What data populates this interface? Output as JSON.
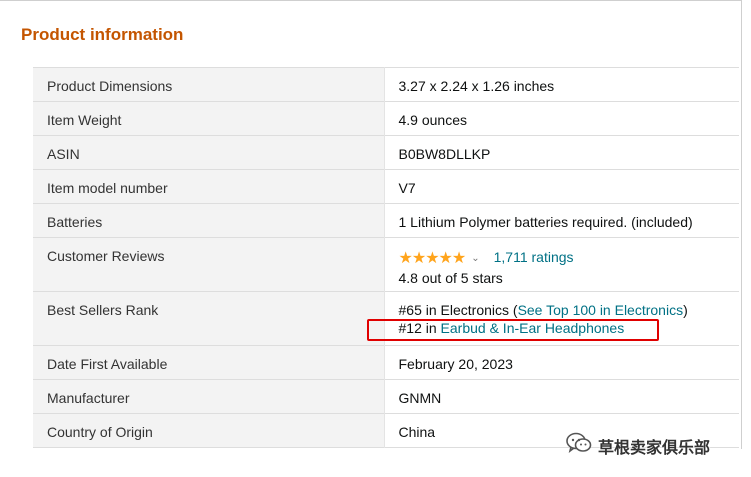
{
  "section_title": "Product information",
  "rows": {
    "dimensions": {
      "label": "Product Dimensions",
      "value": "3.27 x 2.24 x 1.26 inches"
    },
    "weight": {
      "label": "Item Weight",
      "value": "4.9 ounces"
    },
    "asin": {
      "label": "ASIN",
      "value": "B0BW8DLLKP"
    },
    "model": {
      "label": "Item model number",
      "value": "V7"
    },
    "batteries": {
      "label": "Batteries",
      "value": "1 Lithium Polymer batteries required. (included)"
    },
    "reviews": {
      "label": "Customer Reviews",
      "stars": "★★★★★",
      "rating": 4.8,
      "chevron": "⌄",
      "ratings_link": "1,711 ratings",
      "out_of": "4.8 out of 5 stars"
    },
    "rank": {
      "label": "Best Sellers Rank",
      "line1_prefix": "#65 in Electronics (",
      "line1_link": "See Top 100 in Electronics",
      "line1_suffix": ")",
      "line2_prefix": "#12 in ",
      "line2_link": "Earbud & In-Ear Headphones"
    },
    "date": {
      "label": "Date First Available",
      "value": "February 20, 2023"
    },
    "manufacturer": {
      "label": "Manufacturer",
      "value": "GNMN"
    },
    "origin": {
      "label": "Country of Origin",
      "value": "China"
    }
  },
  "colors": {
    "title": "#c45500",
    "link": "#007185",
    "star": "#ffa41c",
    "highlight": "#e00000",
    "label_bg": "#f3f3f3"
  },
  "watermark": {
    "icon": "wechat-icon",
    "text": "草根卖家俱乐部"
  }
}
